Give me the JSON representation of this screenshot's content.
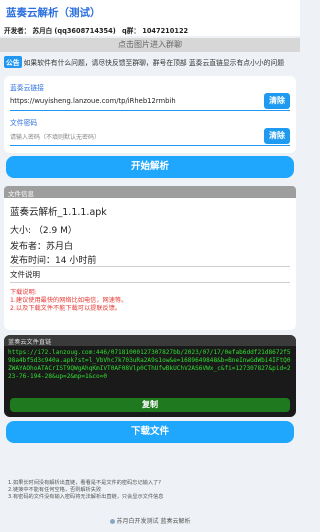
{
  "app": {
    "title": "蓝奏云解析（测试）"
  },
  "developer": {
    "prefix": "开发者：",
    "name": "苏月白",
    "qq": "(qq3608714354)",
    "qgroup": "q群： 1047210122"
  },
  "banner": {
    "label": "点击图片进入群聊"
  },
  "notice": {
    "tag": "公告",
    "text": "如果软件有什么问题，请尽快反馈至群聊，群号在顶部 蓝奏云直链显示有点小小的问题"
  },
  "link_section": {
    "label": "蓝奏云链接",
    "value": "https://wuyisheng.lanzoue.com/tp/iRheb12rmbih",
    "clear_label": "清除"
  },
  "pwd_section": {
    "label": "文件密码",
    "placeholder": "请输入密码（不填则默认无密码）",
    "clear_label": "清除"
  },
  "parse_button": {
    "label": "开始解析"
  },
  "file_info": {
    "header": "文件信息",
    "name": "蓝奏云解析_1.1.1.apk",
    "size": "大小: （2.9 M）",
    "publisher": "发布者：苏月白",
    "publish_time": "发布时间：14 小时前",
    "desc_label": "文件说明",
    "note_title": "下载说明:",
    "note_line1": "1.建议使用最快的网络比如电信，网速等。",
    "note_line2": "2.以及下载文件不能下载可以提联反馈。"
  },
  "direct_link": {
    "header": "蓝奏云文件直链",
    "url": "https://i72.lanzoug.com:446/07181000127307827bb/2023/07/17/0efab6ddf21d8672f598a4bf5d3c940a.apk?st=l_VbVhc7k703uRa2A9s1ow&e=1689649848&b=BneInwGdWbi4IFtQ0ZWAYAOhoATACrIST9QWgAhqKmIVT0AF08Vlp0CThUfwBkUChV2AS6VWx_c&fi=127307827&pid=223-76-194-28&up=2&mp=1&co=0",
    "copy_label": "复制"
  },
  "download_button": {
    "label": "下载文件"
  },
  "tips": {
    "line1": "1.如果长时间没有解析出直链，看看是不是文件的密码忘记输入了?",
    "line2": "2.链接中不能有任何空格，否则解析失败",
    "line3": "3.有密码的文件没有输入密码将无法解析出直链，只会显示文件信息"
  },
  "footer": {
    "text": "苏月白开发测试 蓝奏云解析"
  }
}
